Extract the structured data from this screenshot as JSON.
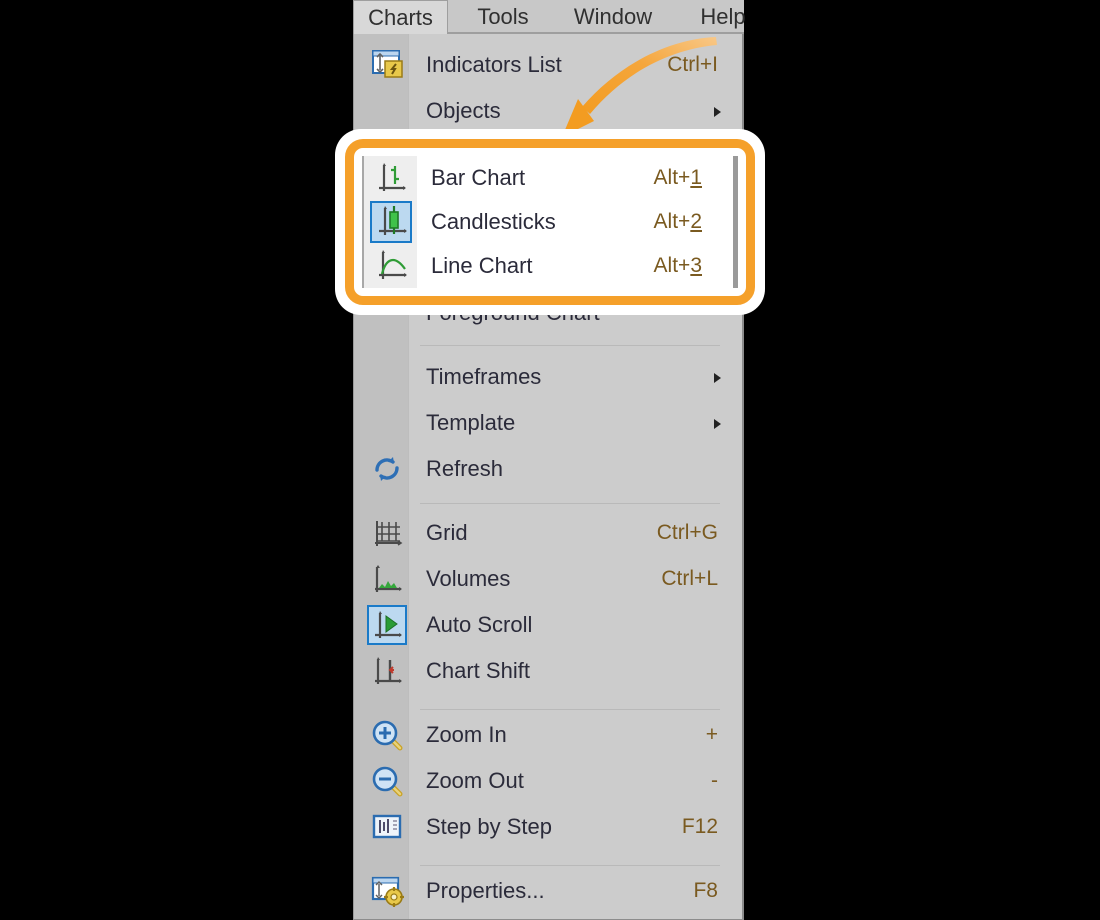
{
  "menubar": {
    "items": [
      {
        "label": "Charts",
        "active": true
      },
      {
        "label": "Tools",
        "active": false
      },
      {
        "label": "Window",
        "active": false
      },
      {
        "label": "Help",
        "active": false
      }
    ]
  },
  "menu": {
    "title": "Charts",
    "items": [
      {
        "label": "Indicators List",
        "accel": "Ctrl+I",
        "icon": "indicators-list-icon",
        "submenu": false,
        "checked": false
      },
      {
        "label": "Objects",
        "accel": "",
        "icon": "",
        "submenu": true,
        "checked": false
      },
      {
        "label": "Bar Chart",
        "accel": "Alt+1",
        "accel_underline": "1",
        "icon": "bar-chart-icon",
        "submenu": false,
        "checked": false
      },
      {
        "label": "Candlesticks",
        "accel": "Alt+2",
        "accel_underline": "2",
        "icon": "candlesticks-icon",
        "submenu": false,
        "checked": true
      },
      {
        "label": "Line Chart",
        "accel": "Alt+3",
        "accel_underline": "3",
        "icon": "line-chart-icon",
        "submenu": false,
        "checked": false
      },
      {
        "label": "Foreground Chart",
        "accel": "",
        "icon": "",
        "submenu": false,
        "checked": false
      },
      {
        "label": "Timeframes",
        "accel": "",
        "icon": "",
        "submenu": true,
        "checked": false
      },
      {
        "label": "Template",
        "accel": "",
        "icon": "",
        "submenu": true,
        "checked": false
      },
      {
        "label": "Refresh",
        "accel": "",
        "icon": "refresh-icon",
        "submenu": false,
        "checked": false
      },
      {
        "label": "Grid",
        "accel": "Ctrl+G",
        "icon": "grid-icon",
        "submenu": false,
        "checked": false
      },
      {
        "label": "Volumes",
        "accel": "Ctrl+L",
        "icon": "volumes-icon",
        "submenu": false,
        "checked": false
      },
      {
        "label": "Auto Scroll",
        "accel": "",
        "icon": "auto-scroll-icon",
        "submenu": false,
        "checked": true
      },
      {
        "label": "Chart Shift",
        "accel": "",
        "icon": "chart-shift-icon",
        "submenu": false,
        "checked": false
      },
      {
        "label": "Zoom In",
        "accel": "+",
        "icon": "zoom-in-icon",
        "submenu": false,
        "checked": false
      },
      {
        "label": "Zoom Out",
        "accel": "-",
        "icon": "zoom-out-icon",
        "submenu": false,
        "checked": false
      },
      {
        "label": "Step by Step",
        "accel": "F12",
        "icon": "step-by-step-icon",
        "submenu": false,
        "checked": false
      },
      {
        "label": "Properties...",
        "accel": "F8",
        "icon": "properties-icon",
        "submenu": false,
        "checked": false
      }
    ]
  },
  "highlight": {
    "label": "chart-type-group-highlight",
    "color": "#f5a02a",
    "items": [
      {
        "label": "Bar Chart",
        "accel": "Alt+1",
        "accel_underline": "1"
      },
      {
        "label": "Candlesticks",
        "accel": "Alt+2",
        "accel_underline": "2"
      },
      {
        "label": "Line Chart",
        "accel": "Alt+3",
        "accel_underline": "3"
      }
    ]
  },
  "annotation": {
    "arrow": "curved-arrow-pointing-to-chart-types",
    "color": "#f5a02a"
  },
  "colors": {
    "menu_background": "#cccccc",
    "icon_column": "#c0c0c0",
    "accent_orange": "#f5a02a",
    "accel_text": "#7a5a20",
    "label_text": "#2b2b3a",
    "selection_border": "#1a7ac8"
  }
}
